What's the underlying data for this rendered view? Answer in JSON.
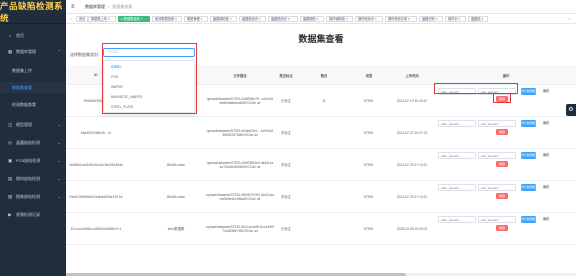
{
  "app": {
    "title": "产品缺陷检测系统"
  },
  "sidebar": {
    "items": [
      {
        "label": "首页",
        "icon": "home-icon",
        "expanded": false
      },
      {
        "label": "数据库管理",
        "icon": "database-icon",
        "expanded": true
      },
      {
        "label": "数据集上传",
        "sub": true
      },
      {
        "label": "数据集查看",
        "sub": true,
        "active": true
      },
      {
        "label": "检测数据查看",
        "sub": true
      },
      {
        "label": "模型管理",
        "icon": "model-icon"
      },
      {
        "label": "晶圆缺陷检测",
        "icon": "wafer-icon"
      },
      {
        "label": "PCB缺陷检测",
        "icon": "pcb-icon"
      },
      {
        "label": "钢材缺陷检测",
        "icon": "steel-icon"
      },
      {
        "label": "图像缺陷检测",
        "icon": "image-icon"
      },
      {
        "label": "视频检测记录",
        "icon": "video-icon"
      }
    ]
  },
  "topbar": {
    "breadcrumb_parent": "数据库管理",
    "breadcrumb_current": "数据集查看"
  },
  "tags": [
    {
      "label": "首页",
      "active": false
    },
    {
      "label": "数据集上传 ×",
      "active": false
    },
    {
      "label": "● 数据集查看 ×",
      "active": true
    },
    {
      "label": "检测数据查看 ×",
      "active": false
    },
    {
      "label": "模型管理 ×",
      "active": false
    },
    {
      "label": "晶圆缺陷检 ×",
      "active": false
    },
    {
      "label": "晶圆检测识 ×",
      "active": false
    },
    {
      "label": "晶圆检测记 ×",
      "active": false
    },
    {
      "label": "晶圆缺陷 ×",
      "active": false
    },
    {
      "label": "钢材缺陷检 ×",
      "active": false
    },
    {
      "label": "钢材检测识 ×",
      "active": false
    },
    {
      "label": "钢材检测记录 ×",
      "active": false
    },
    {
      "label": "晶圆识别 ×",
      "active": false
    },
    {
      "label": "钢材识 ×",
      "active": false
    },
    {
      "label": "晶圆结 ×",
      "active": false
    }
  ],
  "page": {
    "title": "数据集查看",
    "filter_label": "选择数据集类别：",
    "select_placeholder": "STEEL"
  },
  "dropdown": {
    "options": [
      "STEEL",
      "PCB",
      "WAFER",
      "MAGNETIC_WAFER",
      "STEEL_PLATE"
    ],
    "selected": "STEEL"
  },
  "table": {
    "headers": [
      "ID",
      "图片",
      "名称",
      "文件路径",
      "是否标注",
      "数目",
      "类型",
      "上传时间",
      "操作"
    ],
    "input_placeholders": {
      "train": "train_percent",
      "test": "test_percent"
    },
    "buttons": {
      "delete": "删除",
      "submit": "划分数据集",
      "edit": "编辑"
    },
    "rows": [
      {
        "id": "5946bb97b80b...",
        "image": "",
        "name": "",
        "path": "upload/datasets/STEEL/2d8296e75...rc0e2c9bb8e0da8bbd1b5VGCde a4",
        "labeled": "已标注",
        "count": "11",
        "type": "STEEL",
        "time": "2024-07-19 10:40:47"
      },
      {
        "id": "664d5f47b5fe49...7d",
        "image": "",
        "name": "",
        "path": "upload/datasets/STEEL/b9ab57b4 ...1e900d2365302978a5VGCde a4",
        "labeled": "未标注",
        "count": "",
        "type": "STEEL",
        "time": "2024-07-22 10:37:23"
      },
      {
        "id": "0b8f360cea3453d1a4a7d0c5b3494b",
        "image": "",
        "name": "BNWA-main",
        "path": "upload/datasets/STEEL/0bff7f893e0 dadd1ca4a7d0c5b3694b5VGCde a4",
        "labeled": "未标注",
        "count": "",
        "type": "STEEL",
        "time": "2024-07-25 17:10:31"
      },
      {
        "id": "09e647bf5b64b51bab6d954e149 b4",
        "image": "",
        "name": "BNWA-main",
        "path": "upload/datasets/STEEL/0905f7b7f00 d2d21aacfa0b5e4b1bf5a6VGCde a4",
        "labeled": "未标注",
        "count": "",
        "type": "STEEL",
        "time": "2024-07-25 17:10:31"
      },
      {
        "id": "87c1cc4a9b5cc43d9f44d258e7b 4",
        "image": "",
        "name": "steel数据集",
        "path": "upload/datasets/STEEL/87c1cc4a9b 5cc43d9f744d258e7b5VGCde a4",
        "labeled": "已标注",
        "count": "",
        "type": "STEEL",
        "time": "2025-03-08 16:03:03"
      }
    ]
  },
  "colors": {
    "sidebar_bg": "#1f2d3d",
    "accent": "#409eff",
    "active_tag": "#42b983",
    "danger": "#f56c6c",
    "highlight_box": "#e53935"
  }
}
